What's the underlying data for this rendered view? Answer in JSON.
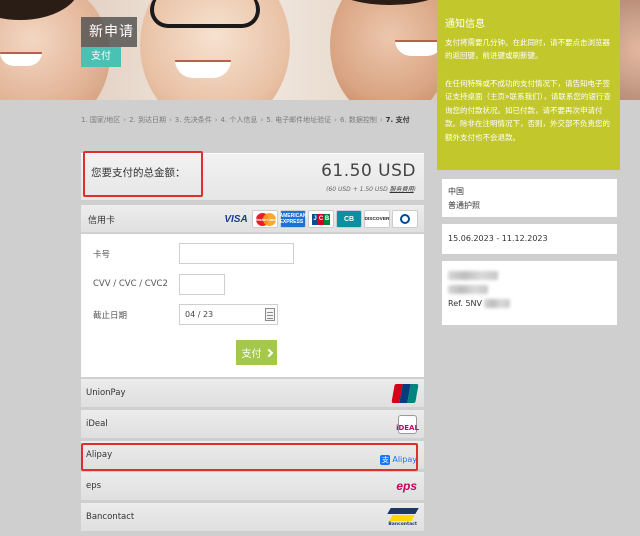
{
  "hero": {
    "title": "新申请",
    "subtitle": "支付"
  },
  "notice": {
    "title": "通知信息",
    "paragraph1": "支付将需要几分钟。在此同时，请不要点击浏览器的返回键，前进键或刷新键。",
    "paragraph2": "在任何特殊或不成功的支付情况下，请告知电子签证支持桌面（主页»联系我们），请联系您的银行查询您的付款状况。如已付款，请不要再次申请付款。除非在注明情况下，否则，外交部不负责您的额外支付也不会退款。"
  },
  "breadcrumb": {
    "steps": [
      "1. 国家/地区",
      "2. 到达日期",
      "3. 先决条件",
      "4. 个人信息",
      "5. 电子邮件地址验证",
      "6. 数据控制"
    ],
    "separator": "›",
    "current": "7. 支付"
  },
  "total": {
    "label": "您要支付的总金额：",
    "amount": "61.50 USD",
    "breakdown_prefix": "(60 USD + 1.50 USD ",
    "fee_link": "服务费用",
    "breakdown_suffix": ")"
  },
  "card": {
    "title": "信用卡",
    "brands": {
      "visa": "VISA",
      "mastercard": "MasterCard",
      "amex": "AMERICAN EXPRESS",
      "jcb": [
        "J",
        "C",
        "B"
      ],
      "cb": "CB",
      "discover": "DISCOVER"
    },
    "fields": {
      "card_number_label": "卡号",
      "cvv_label": "CVV / CVC / CVC2",
      "expiry_label": "截止日期",
      "expiry_value": "04 / 23"
    },
    "pay_button": "支付"
  },
  "methods": {
    "unionpay": "UnionPay",
    "ideal": "iDeal",
    "ideal_logo": "iDEAL",
    "alipay": "Alipay",
    "alipay_logo": "Alipay",
    "alipay_logo_icon": "支",
    "eps": "eps",
    "eps_logo": "eps",
    "bancontact": "Bancontact",
    "bancontact_logo": "Bancontact"
  },
  "sidebar": {
    "country": "中国",
    "passport_type": "普通护照",
    "date_range": "15.06.2023 - 11.12.2023",
    "ref_prefix": "Ref. 5NV"
  },
  "colors": {
    "notice_bg": "#c2c82b",
    "accent_teal": "#49c2b3",
    "pay_button": "#a3c84b",
    "highlight_red": "#e12d2d"
  }
}
